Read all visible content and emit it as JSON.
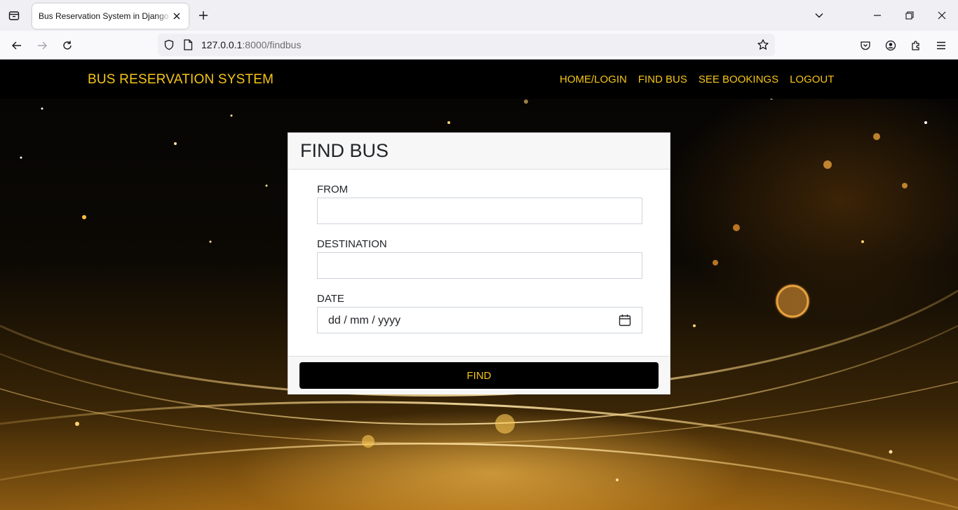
{
  "browser": {
    "tab_title": "Bus Reservation System in Django Framework",
    "url_host": "127.0.0.1",
    "url_path": ":8000/findbus"
  },
  "header": {
    "brand": "BUS RESERVATION SYSTEM",
    "nav": [
      "HOME/LOGIN",
      "FIND BUS",
      "SEE BOOKINGS",
      "LOGOUT"
    ]
  },
  "form": {
    "title": "FIND BUS",
    "from_label": "FROM",
    "from_value": "",
    "destination_label": "DESTINATION",
    "destination_value": "",
    "date_label": "DATE",
    "date_placeholder": "dd / mm / yyyy",
    "submit_label": "FIND"
  },
  "colors": {
    "accent": "#f5c518",
    "header_bg": "#000000",
    "button_bg": "#000000"
  }
}
